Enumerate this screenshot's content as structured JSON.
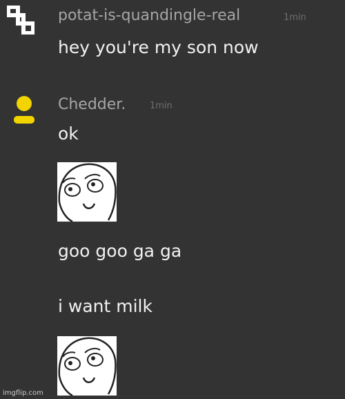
{
  "messages": [
    {
      "username": "potat-is-quandingle-real",
      "timestamp": "1min",
      "lines": [
        "hey you're my son now"
      ]
    },
    {
      "username": "Chedder.",
      "timestamp": "1min",
      "lines": [
        "ok",
        "goo goo ga ga",
        "i want milk"
      ],
      "stickers": [
        "derp-face-sticker",
        "derp-face-sticker"
      ]
    }
  ],
  "avatar_colors": {
    "user1": "#ffffff",
    "user2": "#f2d400"
  },
  "watermark": "imgflip.com"
}
